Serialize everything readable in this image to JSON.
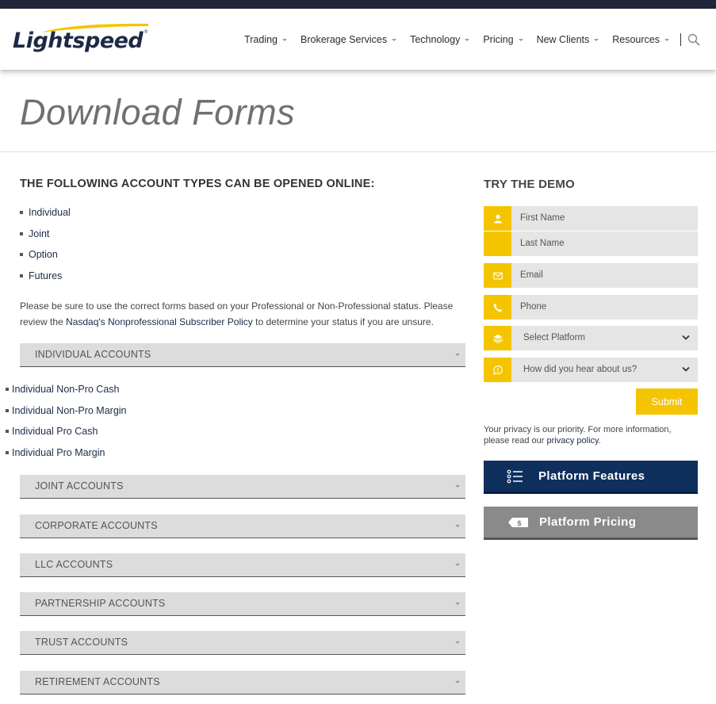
{
  "brand": {
    "name": "Lightspeed",
    "accent": "#f5c400",
    "navy": "#0f2f5c"
  },
  "nav": {
    "items": [
      {
        "label": "Trading"
      },
      {
        "label": "Brokerage Services"
      },
      {
        "label": "Technology"
      },
      {
        "label": "Pricing"
      },
      {
        "label": "New Clients"
      },
      {
        "label": "Resources"
      }
    ],
    "search_icon": "search-icon"
  },
  "page": {
    "title": "Download Forms"
  },
  "main": {
    "heading": "THE FOLLOWING ACCOUNT TYPES CAN BE OPENED ONLINE:",
    "account_types": [
      "Individual",
      "Joint",
      "Option",
      "Futures"
    ],
    "note_before": "Please be sure to use the correct forms based on your Professional or Non-Professional status. Please review the ",
    "note_link": "Nasdaq's Nonprofessional Subscriber Policy",
    "note_after": " to determine your status if you are unsure.",
    "sections": [
      "INDIVIDUAL ACCOUNTS",
      "JOINT ACCOUNTS",
      "CORPORATE ACCOUNTS",
      "LLC ACCOUNTS",
      "PARTNERSHIP ACCOUNTS",
      "TRUST ACCOUNTS",
      "RETIREMENT ACCOUNTS"
    ],
    "individual_forms": [
      "Individual Non-Pro Cash",
      "Individual Non-Pro Margin",
      "Individual Pro Cash",
      "Individual Pro Margin"
    ]
  },
  "demo": {
    "title": "TRY THE DEMO",
    "fields": {
      "first_name": "First Name",
      "last_name": "Last Name",
      "email": "Email",
      "phone": "Phone",
      "platform": "Select Platform",
      "referral": "How did you hear about us?"
    },
    "submit": "Submit",
    "privacy_before": "Your privacy is our priority. For more information, please read our ",
    "privacy_link": "privacy policy",
    "privacy_after": "."
  },
  "cta": {
    "features": "Platform Features",
    "pricing": "Platform Pricing"
  }
}
